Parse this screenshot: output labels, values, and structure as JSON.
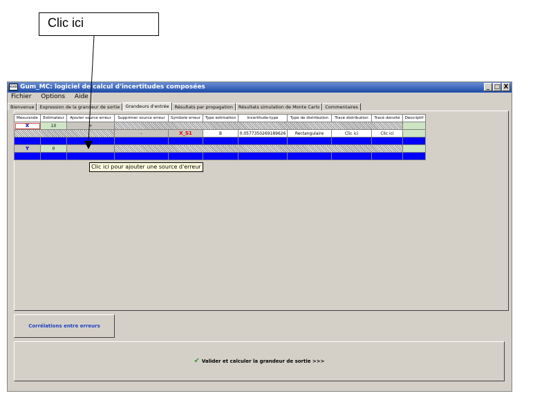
{
  "callout": {
    "text": "Clic ici"
  },
  "window": {
    "title": "Gum_MC: logiciel de calcul d'incertitudes composées",
    "app_icon_label": "exe",
    "buttons": {
      "minimize": "_",
      "maximize": "□",
      "close": "X"
    }
  },
  "menu": {
    "items": [
      "Fichier",
      "Options",
      "Aide"
    ]
  },
  "tabs": [
    {
      "label": "Bienvenue",
      "active": false
    },
    {
      "label": "Expression de la grandeur de sortie",
      "active": false
    },
    {
      "label": "Grandeurs d'entrée",
      "active": true
    },
    {
      "label": "Résultats par propagation",
      "active": false
    },
    {
      "label": "Résultats simulation de Monte Carlo",
      "active": false
    },
    {
      "label": "Commentaires",
      "active": false
    }
  ],
  "table": {
    "headers": [
      "Mesurande",
      "Estimateur",
      "Ajouter source erreur",
      "Supprimer source erreur",
      "Symbole erreur",
      "Type estimation",
      "Incertitude-type",
      "Type de distribution",
      "Tracé distribution",
      "Tracé densité",
      "Descriptif"
    ],
    "rows": {
      "x": {
        "mesurande": "X",
        "estimateur": "10",
        "ajouter": "+"
      },
      "x_s1": {
        "supprimer": "-",
        "symbole": "X_S1",
        "type": "B",
        "incertitude": "0.0577350269189626",
        "distribution": "Rectangulaire",
        "trace_distribution": "Clic ici",
        "trace_densite": "Clic ici"
      },
      "y": {
        "mesurande": "Y",
        "estimateur": "0"
      }
    }
  },
  "tooltip": {
    "text": "Clic ici pour ajouter une source d'erreur"
  },
  "correlations_button": {
    "label": "Corrélations entre erreurs"
  },
  "validate_button": {
    "label": "Valider et calculer la grandeur de sortie >>>",
    "icon": "check-icon"
  }
}
